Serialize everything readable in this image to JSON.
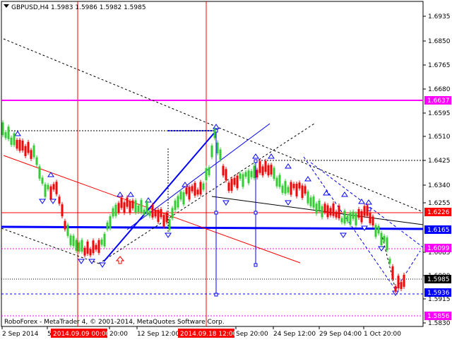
{
  "header": {
    "icon": "chart-icon",
    "title": "GBPUSD,H4  1.5983 1.5986 1.5982 1.5985"
  },
  "footer": {
    "copyright": "RoboForex - MetaTrader 4, © 2001-2014, MetaQuotes Software Corp."
  },
  "colors": {
    "bull": "#33cc33",
    "bear": "#ff0000",
    "level_upper": "#ff00ff",
    "level_red": "#ff0000",
    "trend_blue": "#0000ff",
    "bid_line": "#000000",
    "vline": "#ff0000"
  },
  "price_axis": {
    "ticks": [
      "1.6935",
      "1.6850",
      "1.6765",
      "1.6680",
      "1.6595",
      "1.6510",
      "1.6425",
      "1.6340",
      "1.6255",
      "1.6085",
      "1.6000",
      "1.5915",
      "1.5830"
    ],
    "badges": [
      {
        "label": "1.6637",
        "kind": "magenta"
      },
      {
        "label": "1.6226",
        "kind": "red"
      },
      {
        "label": "1.6165",
        "kind": "blue"
      },
      {
        "label": "1.6099",
        "kind": "magenta"
      },
      {
        "label": "1.5985",
        "kind": "black"
      },
      {
        "label": "1.5936",
        "kind": "blue"
      },
      {
        "label": "1.5856",
        "kind": "magenta"
      }
    ]
  },
  "time_axis": {
    "labels": [
      "2 Sep 2014",
      "5",
      "20:00",
      "12 Sep 12:00",
      "Sep 20:00",
      "24 Sep 12:00",
      "29 Sep 04:00",
      "1 Oct 20:00"
    ],
    "highlights": [
      "2014.09.09 00:00",
      "2014.09.18 12:00"
    ]
  }
}
